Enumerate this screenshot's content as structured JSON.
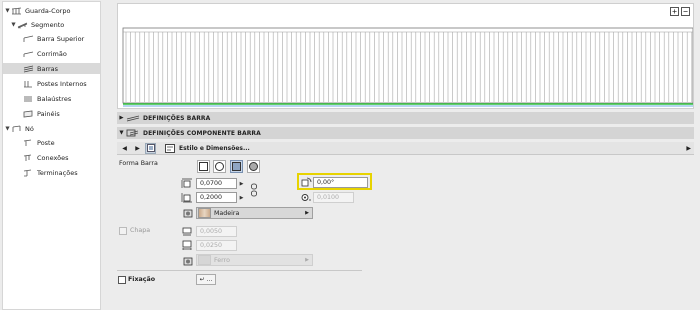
{
  "tree": {
    "items": [
      {
        "label": "Guarda-Corpo",
        "icon": "railing-icon"
      },
      {
        "label": "Segmento",
        "icon": "segment-icon"
      },
      {
        "label": "Barra Superior",
        "icon": "top-rail-icon"
      },
      {
        "label": "Corrimão",
        "icon": "handrail-icon"
      },
      {
        "label": "Barras",
        "icon": "rails-icon"
      },
      {
        "label": "Postes Internos",
        "icon": "inner-post-icon"
      },
      {
        "label": "Balaústres",
        "icon": "baluster-icon"
      },
      {
        "label": "Painéis",
        "icon": "panel-icon"
      },
      {
        "label": "Nó",
        "icon": "node-icon"
      },
      {
        "label": "Poste",
        "icon": "post-icon"
      },
      {
        "label": "Conexões",
        "icon": "connection-icon"
      },
      {
        "label": "Terminações",
        "icon": "end-icon"
      }
    ],
    "selected": "Barras"
  },
  "preview": {
    "zoom_in": "+",
    "zoom_out": "−",
    "colors": {
      "floor_green": "#2fbf3a",
      "floor_blue": "#3f8fd6",
      "lines": "#a8a8a8"
    }
  },
  "sections": {
    "definicoes_barra": "DEFINIÇÕES BARRA",
    "definicoes_componente": "DEFINIÇÕES COMPONENTE BARRA"
  },
  "toolbar": {
    "label": "Estilo e Dimensões..."
  },
  "props": {
    "forma_label": "Forma Barra",
    "width_value": "0,0700",
    "height_value": "0,2000",
    "angle_value": "0,00°",
    "offset_value": "0,0100",
    "material": "Madeira",
    "chapa_label": "Chapa",
    "chapa_thickness": "0,0050",
    "chapa_width": "0,0250",
    "chapa_material": "Ferro",
    "fixacao_label": "Fixação",
    "fixacao_button": "↵ ...",
    "colors": {
      "highlight": "#e7d300",
      "selected_shape": "#c7d6ea"
    }
  }
}
